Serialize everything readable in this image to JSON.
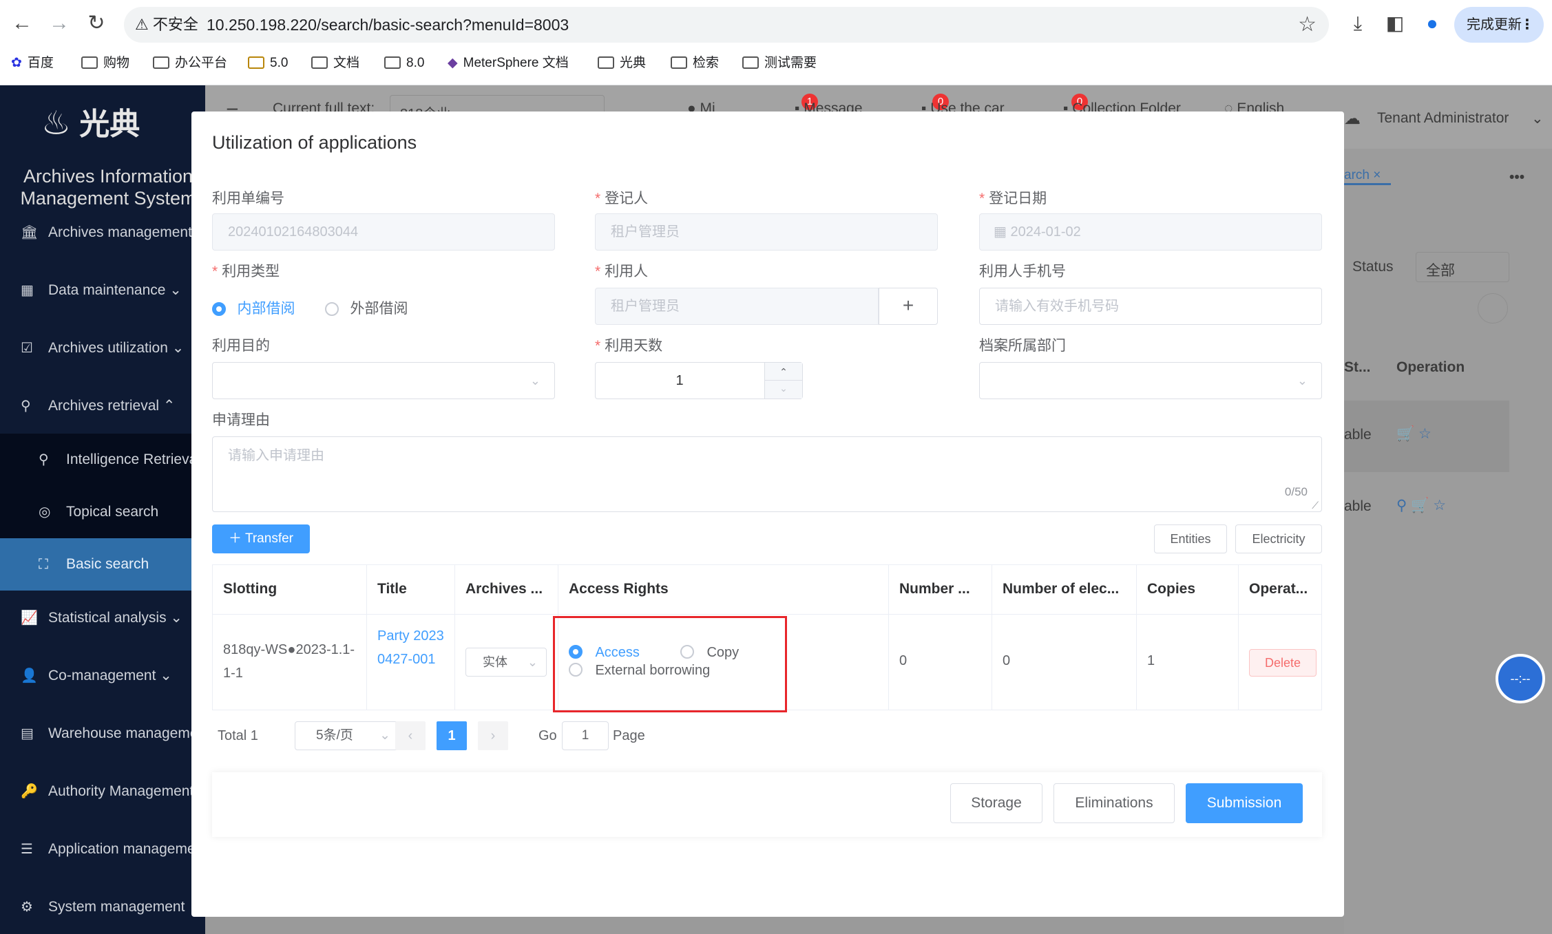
{
  "browser": {
    "insecure_label": "不安全",
    "url": "10.250.198.220/search/basic-search?menuId=8003",
    "update_label": "完成更新",
    "bookmarks": [
      "百度",
      "购物",
      "办公平台",
      "5.0",
      "文档",
      "8.0",
      "MeterSphere 文档",
      "光典",
      "检索",
      "测试需要"
    ]
  },
  "sidebar": {
    "logo_text": "光典",
    "app_title": "Archives Information Management System",
    "items": [
      {
        "label": "Archives management",
        "icon": "bank-icon"
      },
      {
        "label": "Data maintenance",
        "icon": "data-icon"
      },
      {
        "label": "Archives utilization",
        "icon": "clipboard-icon"
      },
      {
        "label": "Archives retrieval",
        "icon": "search-icon"
      },
      {
        "label": "Intelligence Retrieval",
        "icon": "search-icon"
      },
      {
        "label": "Topical search",
        "icon": "compass-icon"
      },
      {
        "label": "Basic search",
        "icon": "scan-icon"
      },
      {
        "label": "Statistical analysis",
        "icon": "chart-icon"
      },
      {
        "label": "Co-management",
        "icon": "users-icon"
      },
      {
        "label": "Warehouse management",
        "icon": "warehouse-icon"
      },
      {
        "label": "Authority Management",
        "icon": "key-icon"
      },
      {
        "label": "Application management",
        "icon": "list-icon"
      },
      {
        "label": "System management",
        "icon": "gear-icon"
      }
    ]
  },
  "background": {
    "current_fulltext_label": "Current full text:",
    "current_fulltext_value": "818企业",
    "message_label": "Message",
    "message_count": "1",
    "cart_label": "Use the car",
    "cart_count": "0",
    "collection_label": "Collection Folder",
    "collection_count": "0",
    "language_label": "English",
    "user_label": "Tenant Administrator",
    "tab_label": "arch",
    "status_label": "Status",
    "status_value": "全部",
    "col_status": "St...",
    "col_operation": "Operation",
    "row1_status": "able",
    "row2_status": "able"
  },
  "modal": {
    "title": "Utilization of applications",
    "fields": {
      "form_no_label": "利用单编号",
      "form_no_value": "20240102164803044",
      "registrar_label": "登记人",
      "registrar_value": "租户管理员",
      "reg_date_label": "登记日期",
      "reg_date_value": "2024-01-02",
      "util_type_label": "利用类型",
      "util_type_internal": "内部借阅",
      "util_type_external": "外部借阅",
      "user_label": "利用人",
      "user_value": "租户管理员",
      "phone_label": "利用人手机号",
      "phone_placeholder": "请输入有效手机号码",
      "purpose_label": "利用目的",
      "days_label": "利用天数",
      "days_value": "1",
      "dept_label": "档案所属部门",
      "reason_label": "申请理由",
      "reason_placeholder": "请输入申请理由",
      "reason_count": "0/50"
    },
    "transfer_label": "Transfer",
    "entities_label": "Entities",
    "electricity_label": "Electricity",
    "table": {
      "headers": [
        "Slotting",
        "Title",
        "Archives ...",
        "Access Rights",
        "Number ...",
        "Number of elec...",
        "Copies",
        "Operat..."
      ],
      "rows": [
        {
          "slotting": "818qy-WS●2023-1.1-1-1",
          "title": "Party 20230427-001",
          "archive_type": "实体",
          "access": "Access",
          "copy": "Copy",
          "external": "External borrowing",
          "number": "0",
          "number_elec": "0",
          "copies": "1",
          "delete_label": "Delete"
        }
      ]
    },
    "pagination": {
      "total": "Total 1",
      "page_size": "5条/页",
      "current_page": "1",
      "go_label": "Go",
      "go_value": "1",
      "page_label": "Page"
    },
    "footer": {
      "storage_label": "Storage",
      "eliminations_label": "Eliminations",
      "submission_label": "Submission"
    }
  }
}
